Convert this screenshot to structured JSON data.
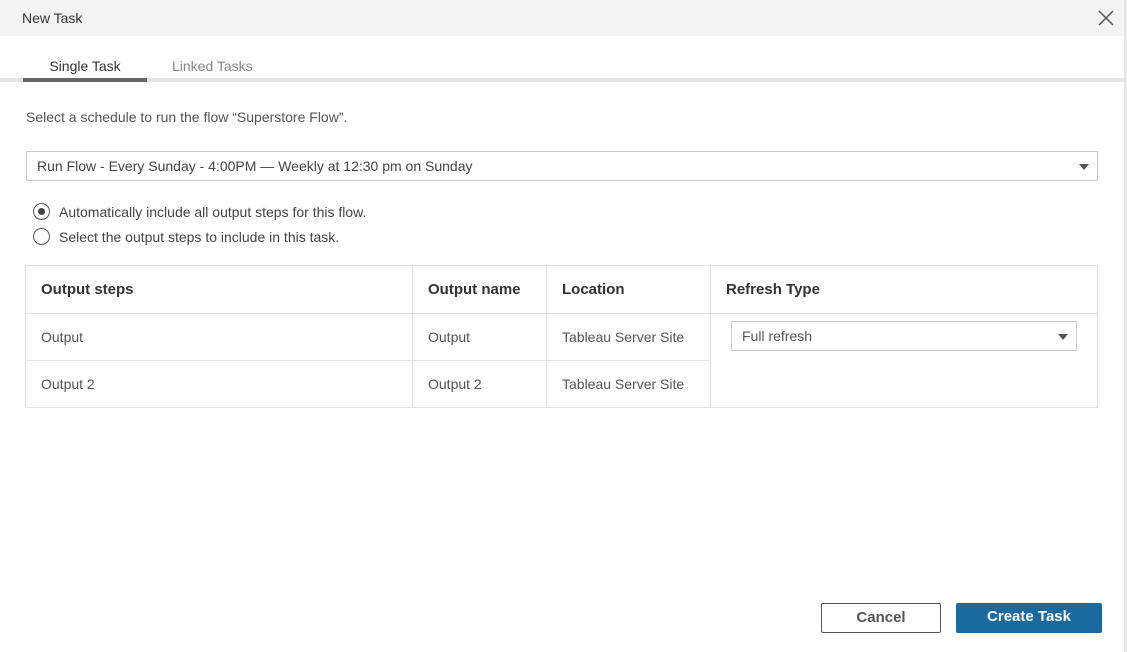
{
  "dialog": {
    "title": "New Task"
  },
  "tabs": [
    {
      "label": "Single Task",
      "active": true
    },
    {
      "label": "Linked Tasks",
      "active": false
    }
  ],
  "prompt": "Select a schedule to run the flow “Superstore Flow”.",
  "schedule": {
    "value": "Run Flow - Every Sunday - 4:00PM — Weekly at 12:30 pm on Sunday"
  },
  "options": [
    {
      "label": "Automatically include all output steps for this flow.",
      "selected": true
    },
    {
      "label": "Select the output steps to include in this task.",
      "selected": false
    }
  ],
  "table": {
    "headers": [
      "Output steps",
      "Output name",
      "Location",
      "Refresh Type"
    ],
    "rows": [
      [
        "Output",
        "Output",
        "Tableau Server Site"
      ],
      [
        "Output 2",
        "Output 2",
        "Tableau Server Site"
      ]
    ],
    "refresh_type": "Full refresh"
  },
  "buttons": {
    "cancel": "Cancel",
    "create": "Create Task"
  },
  "colors": {
    "primary": "#1a6aa0"
  }
}
